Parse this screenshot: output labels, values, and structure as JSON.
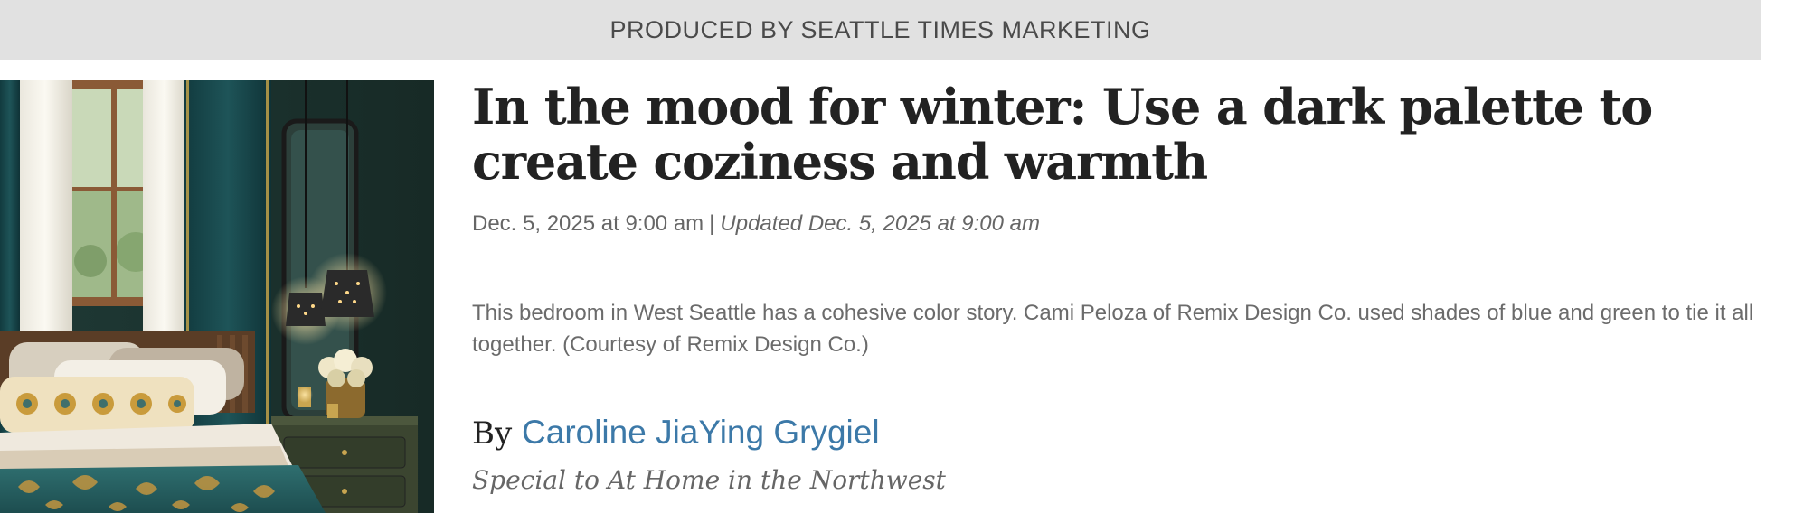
{
  "banner": {
    "text": "PRODUCED BY SEATTLE TIMES MARKETING"
  },
  "article": {
    "headline": "In the mood for winter: Use a dark palette to create coziness and warmth",
    "published": "Dec. 5, 2025 at 9:00 am",
    "separator": "|",
    "updated": "Updated Dec. 5, 2025 at 9:00 am",
    "caption": "This bedroom in West Seattle has a cohesive color story. Cami Peloza of Remix Design Co. used shades of blue and green to tie it all together. (Courtesy of Remix Design Co.)",
    "byline_prefix": "By",
    "author": "Caroline JiaYing Grygiel",
    "affiliation": "Special to At Home in the Northwest"
  },
  "image": {
    "subject": "dark teal bedroom with pendant lamps and patterned bedding",
    "icon": "photo-icon"
  },
  "colors": {
    "banner_bg": "#e1e1e1",
    "author_link": "#3c79a8",
    "headline": "#222222",
    "meta_text": "#666666"
  }
}
